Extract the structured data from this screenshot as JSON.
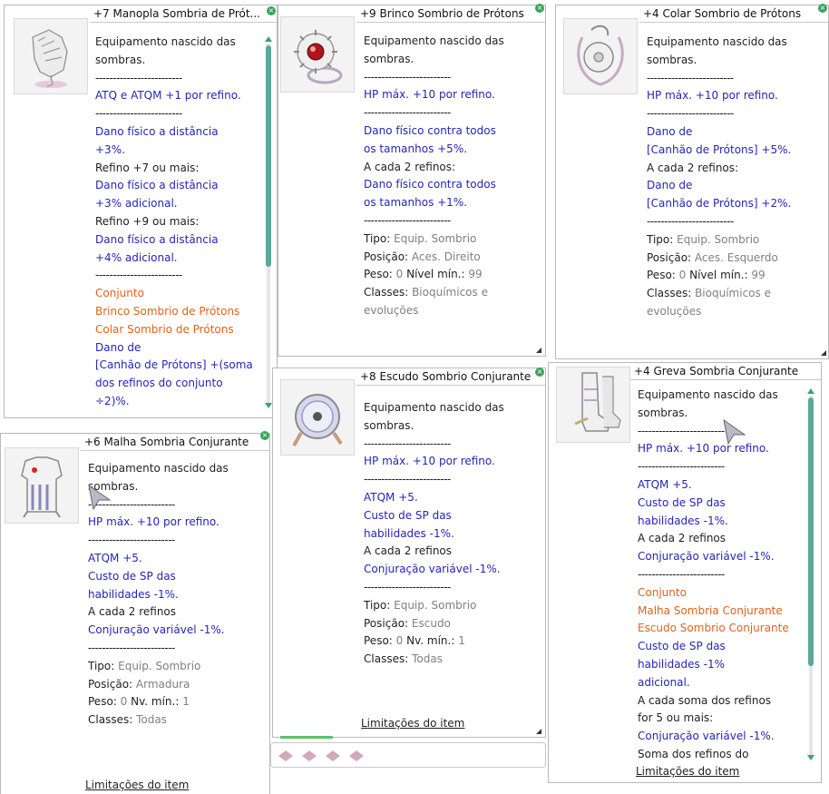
{
  "windows": [
    {
      "title": "+7 Manopla Sombria de Prót...",
      "lines": [
        {
          "t": "Equipamento nascido das",
          "c": "c-black"
        },
        {
          "t": "sombras.",
          "c": "c-black"
        },
        {
          "t": "-------------------------",
          "c": "sep"
        },
        {
          "t": "ATQ e ATQM +1 por refino.",
          "c": "c-blue"
        },
        {
          "t": "-------------------------",
          "c": "sep"
        },
        {
          "t": "Dano físico a distância",
          "c": "c-blue"
        },
        {
          "t": "+3%.",
          "c": "c-blue"
        },
        {
          "t": "Refino +7 ou mais:",
          "c": "c-black"
        },
        {
          "t": "Dano físico a distância",
          "c": "c-blue"
        },
        {
          "t": "+3% adicional.",
          "c": "c-blue"
        },
        {
          "t": "Refino +9 ou mais:",
          "c": "c-black"
        },
        {
          "t": "Dano físico a distância",
          "c": "c-blue"
        },
        {
          "t": "+4% adicional.",
          "c": "c-blue"
        },
        {
          "t": "-------------------------",
          "c": "sep"
        },
        {
          "t": "Conjunto",
          "c": "c-orange"
        },
        {
          "t": "Brinco Sombrio de Prótons",
          "c": "c-orange"
        },
        {
          "t": "Colar Sombrio de Prótons",
          "c": "c-orange"
        },
        {
          "t": "Dano de",
          "c": "c-blue"
        },
        {
          "t": "[Canhão de Prótons] +(soma",
          "c": "c-blue"
        },
        {
          "t": "dos refinos do conjunto",
          "c": "c-blue"
        },
        {
          "t": "÷2)%.",
          "c": "c-blue"
        }
      ]
    },
    {
      "title": "+9 Brinco Sombrio de Prótons",
      "lines": [
        {
          "t": "Equipamento nascido das",
          "c": "c-black"
        },
        {
          "t": "sombras.",
          "c": "c-black"
        },
        {
          "t": "-------------------------",
          "c": "sep"
        },
        {
          "t": "HP máx. +10 por refino.",
          "c": "c-blue"
        },
        {
          "t": "-------------------------",
          "c": "sep"
        },
        {
          "t": "Dano físico contra todos",
          "c": "c-blue"
        },
        {
          "t": "os tamanhos +5%.",
          "c": "c-blue"
        },
        {
          "t": "A cada 2 refinos:",
          "c": "c-black"
        },
        {
          "t": "Dano físico contra todos",
          "c": "c-blue"
        },
        {
          "t": "os tamanhos +1%.",
          "c": "c-blue"
        },
        {
          "t": "-------------------------",
          "c": "sep"
        }
      ],
      "info": [
        {
          "label": "Tipo:",
          "value": "Equip. Sombrio"
        },
        {
          "label": "Posição:",
          "value": "Aces. Direito"
        },
        {
          "label": "Peso:",
          "value": "0",
          "label2": "Nível mín.:",
          "value2": "99"
        },
        {
          "label": "Classes:",
          "value": "Bioquímicos e"
        },
        {
          "label": "",
          "value": "evoluções"
        }
      ]
    },
    {
      "title": "+4 Colar Sombrio de Prótons",
      "lines": [
        {
          "t": "Equipamento nascido das",
          "c": "c-black"
        },
        {
          "t": "sombras.",
          "c": "c-black"
        },
        {
          "t": "-------------------------",
          "c": "sep"
        },
        {
          "t": "HP máx. +10 por refino.",
          "c": "c-blue"
        },
        {
          "t": "-------------------------",
          "c": "sep"
        },
        {
          "t": "Dano de",
          "c": "c-blue"
        },
        {
          "t": "[Canhão de Prótons] +5%.",
          "c": "c-blue"
        },
        {
          "t": "A cada 2 refinos:",
          "c": "c-black"
        },
        {
          "t": "Dano de",
          "c": "c-blue"
        },
        {
          "t": "[Canhão de Prótons] +2%.",
          "c": "c-blue"
        },
        {
          "t": "-------------------------",
          "c": "sep"
        }
      ],
      "info": [
        {
          "label": "Tipo:",
          "value": "Equip. Sombrio"
        },
        {
          "label": "Posição:",
          "value": "Aces. Esquerdo"
        },
        {
          "label": "Peso:",
          "value": "0",
          "label2": "Nível mín.:",
          "value2": "99"
        },
        {
          "label": "Classes:",
          "value": "Bioquímicos e"
        },
        {
          "label": "",
          "value": "evoluções"
        }
      ]
    },
    {
      "title": "+6 Malha Sombria Conjurante",
      "lines": [
        {
          "t": "Equipamento nascido das",
          "c": "c-black"
        },
        {
          "t": "sombras.",
          "c": "c-black"
        },
        {
          "t": "-------------------------",
          "c": "sep"
        },
        {
          "t": "HP máx. +10 por refino.",
          "c": "c-blue"
        },
        {
          "t": "-------------------------",
          "c": "sep"
        },
        {
          "t": "ATQM +5.",
          "c": "c-blue"
        },
        {
          "t": "Custo de SP das",
          "c": "c-blue"
        },
        {
          "t": "habilidades -1%.",
          "c": "c-blue"
        },
        {
          "t": "A cada 2 refinos",
          "c": "c-black"
        },
        {
          "t": "Conjuração variável -1%.",
          "c": "c-blue"
        },
        {
          "t": "-------------------------",
          "c": "sep"
        }
      ],
      "info": [
        {
          "label": "Tipo:",
          "value": "Equip. Sombrio"
        },
        {
          "label": "Posição:",
          "value": "Armadura"
        },
        {
          "label": "Peso:",
          "value": "0",
          "label2": "Nv. mín.:",
          "value2": "1"
        },
        {
          "label": "Classes:",
          "value": "Todas"
        }
      ],
      "limit": "Limitações do item"
    },
    {
      "title": "+8 Escudo Sombrio Conjurante",
      "lines": [
        {
          "t": "Equipamento nascido das",
          "c": "c-black"
        },
        {
          "t": "sombras.",
          "c": "c-black"
        },
        {
          "t": "-------------------------",
          "c": "sep"
        },
        {
          "t": "HP máx. +10 por refino.",
          "c": "c-blue"
        },
        {
          "t": "-------------------------",
          "c": "sep"
        },
        {
          "t": "ATQM +5.",
          "c": "c-blue"
        },
        {
          "t": "Custo de SP das",
          "c": "c-blue"
        },
        {
          "t": "habilidades -1%.",
          "c": "c-blue"
        },
        {
          "t": "A cada 2 refinos",
          "c": "c-black"
        },
        {
          "t": "Conjuração variável -1%.",
          "c": "c-blue"
        },
        {
          "t": "-------------------------",
          "c": "sep"
        }
      ],
      "info": [
        {
          "label": "Tipo:",
          "value": "Equip. Sombrio"
        },
        {
          "label": "Posição:",
          "value": "Escudo"
        },
        {
          "label": "Peso:",
          "value": "0",
          "label2": "Nv. mín.:",
          "value2": "1"
        },
        {
          "label": "Classes:",
          "value": "Todas"
        }
      ],
      "limit": "Limitações do item"
    },
    {
      "title": "+4 Greva Sombria Conjurante",
      "lines": [
        {
          "t": "Equipamento nascido das",
          "c": "c-black"
        },
        {
          "t": "sombras.",
          "c": "c-black"
        },
        {
          "t": "-------------------------",
          "c": "sep"
        },
        {
          "t": "HP máx. +10 por refino.",
          "c": "c-blue"
        },
        {
          "t": "-------------------------",
          "c": "sep"
        },
        {
          "t": "ATQM +5.",
          "c": "c-blue"
        },
        {
          "t": "Custo de SP das",
          "c": "c-blue"
        },
        {
          "t": "habilidades -1%.",
          "c": "c-blue"
        },
        {
          "t": "A cada 2 refinos",
          "c": "c-black"
        },
        {
          "t": "Conjuração variável -1%.",
          "c": "c-blue"
        },
        {
          "t": "-------------------------",
          "c": "sep"
        },
        {
          "t": "Conjunto",
          "c": "c-orange"
        },
        {
          "t": "Malha Sombria Conjurante",
          "c": "c-orange"
        },
        {
          "t": "Escudo Sombrio Conjurante",
          "c": "c-orange"
        },
        {
          "t": "Custo de SP das",
          "c": "c-blue"
        },
        {
          "t": "habilidades -1%",
          "c": "c-blue"
        },
        {
          "t": "adicional.",
          "c": "c-blue"
        },
        {
          "t": "A cada soma dos refinos",
          "c": "c-black"
        },
        {
          "t": "for 5 ou mais:",
          "c": "c-black"
        },
        {
          "t": "Conjuração variável -1%.",
          "c": "c-blue"
        },
        {
          "t": "Soma dos refinos do",
          "c": "c-black"
        }
      ],
      "limit": "Limitações do item"
    }
  ],
  "colors": {
    "blue": "#2525b8",
    "orange": "#e0631c",
    "gray": "#808080",
    "scroll": "#5aa89a",
    "close": "#39a35c"
  }
}
